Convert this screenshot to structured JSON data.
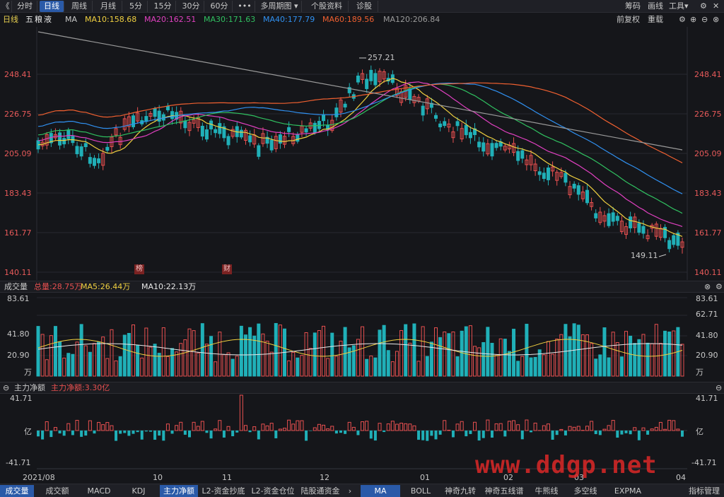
{
  "toolbar": {
    "back_icon": "《",
    "buttons": [
      "分时",
      "日线",
      "周线",
      "月线",
      "5分",
      "15分",
      "30分",
      "60分",
      "•••",
      "多周期图",
      "个股资料",
      "诊股"
    ],
    "right": [
      "筹码",
      "画线",
      "工具"
    ]
  },
  "legend": {
    "period": "日线",
    "stock": "五粮液",
    "ma_label": "MA",
    "items": [
      {
        "label": "MA10:158.68",
        "color": "#f0d040"
      },
      {
        "label": "MA20:162.51",
        "color": "#e040c0"
      },
      {
        "label": "MA30:171.63",
        "color": "#30c060"
      },
      {
        "label": "MA40:177.79",
        "color": "#3090f0"
      },
      {
        "label": "MA60:189.56",
        "color": "#f06030"
      },
      {
        "label": "MA120:206.84",
        "color": "#9a9a9a"
      }
    ],
    "right": [
      "前复权",
      "重载"
    ]
  },
  "price_axis": [
    "248.41",
    "226.75",
    "205.09",
    "183.43",
    "161.77",
    "140.11"
  ],
  "annotations": {
    "high": "257.21",
    "low": "149.11",
    "tag1": "榜",
    "tag2": "财"
  },
  "volume": {
    "title": "成交量",
    "total": "总量:28.75万",
    "ma5": "MA5:26.44万",
    "ma10": "MA10:22.13万",
    "axis": [
      "83.61",
      "62.71",
      "41.80",
      "20.90",
      "万"
    ]
  },
  "flow": {
    "title": "主力净额",
    "value": "主力净额:3.30亿",
    "axis": [
      "41.71",
      "亿",
      "-41.71"
    ]
  },
  "dates": [
    "2021/08",
    "10",
    "11",
    "12",
    "01",
    "02",
    "03",
    "04"
  ],
  "bottom_tabs": [
    "成交量",
    "成交额",
    "MACD",
    "KDJ",
    "主力净额",
    "L2-资金抄底",
    "L2-资金仓位",
    "陆股通资金",
    "MA",
    "BOLL",
    "神奇九转",
    "神奇五线谱",
    "牛熊线",
    "多空线",
    "EXPMA",
    "指标管理"
  ],
  "watermark": "www.ddgp.net",
  "colors": {
    "up": "#e85050",
    "down": "#20b0b8",
    "bg": "#15161a"
  }
}
